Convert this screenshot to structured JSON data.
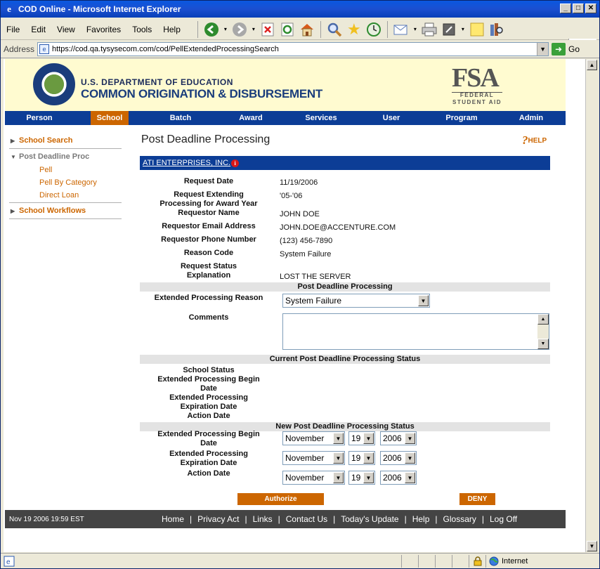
{
  "window": {
    "title": "COD Online - Microsoft Internet Explorer",
    "min_label": "_",
    "max_label": "□",
    "close_label": "✕"
  },
  "menu": {
    "items": [
      {
        "label": "File"
      },
      {
        "label": "Edit"
      },
      {
        "label": "View"
      },
      {
        "label": "Favorites"
      },
      {
        "label": "Tools"
      },
      {
        "label": "Help"
      }
    ]
  },
  "address": {
    "label": "Address",
    "url": "https://cod.qa.tysysecom.com/cod/PellExtendedProcessingSearch",
    "go_label": "Go"
  },
  "status": {
    "zone": "Internet"
  },
  "header": {
    "dept_line1": "U.S. DEPARTMENT OF EDUCATION",
    "dept_line2": "COMMON ORIGINATION & DISBURSEMENT",
    "fsa": "FSA",
    "fsa_sub1": "FEDERAL",
    "fsa_sub2": "STUDENT AID"
  },
  "nav": {
    "items": [
      {
        "label": "Person"
      },
      {
        "label": "School"
      },
      {
        "label": "Batch"
      },
      {
        "label": "Award"
      },
      {
        "label": "Services"
      },
      {
        "label": "User"
      },
      {
        "label": "Program"
      },
      {
        "label": "Admin"
      }
    ],
    "active": "School"
  },
  "sidebar": {
    "school_search": "School Search",
    "post_deadline": "Post Deadline Proc",
    "sub_items": [
      "Pell",
      "Pell By Category",
      "Direct Loan"
    ],
    "school_workflows": "School Workflows"
  },
  "page": {
    "title": "Post Deadline Processing",
    "help": "HELP",
    "school_name": "ATI ENTERPRISES, INC.",
    "info_glyph": "i"
  },
  "request": {
    "request_date_label": "Request Date",
    "request_date": "11/19/2006",
    "award_year_label_1": "Request Extending",
    "award_year_label_2": "Processing for Award Year",
    "award_year": "'05-'06",
    "requestor_name_label": "Requestor Name",
    "requestor_name": "JOHN DOE",
    "email_label": "Requestor Email Address",
    "email": "JOHN.DOE@ACCENTURE.COM",
    "phone_label": "Requestor Phone Number",
    "phone": "(123) 456-7890",
    "reason_code_label": "Reason Code",
    "reason_code": "System Failure",
    "status_expl_label_1": "Request Status",
    "status_expl_label_2": "Explanation",
    "status_expl": "LOST THE SERVER"
  },
  "pdp": {
    "header": "Post Deadline Processing",
    "ext_reason_label": "Extended Processing Reason",
    "ext_reason_value": "System Failure",
    "comments_label": "Comments"
  },
  "current_status": {
    "header": "Current Post Deadline Processing Status",
    "school_status_label": "School Status",
    "begin_label_1": "Extended Processing Begin",
    "begin_label_2": "Date",
    "exp_label_1": "Extended Processing",
    "exp_label_2": "Expiration Date",
    "action_label": "Action Date"
  },
  "new_status": {
    "header": "New Post Deadline Processing Status",
    "begin_label_1": "Extended Processing Begin",
    "begin_label_2": "Date",
    "exp_label_1": "Extended Processing",
    "exp_label_2": "Expiration Date",
    "action_label": "Action Date",
    "begin": {
      "month": "November",
      "day": "19",
      "year": "2006"
    },
    "expiration": {
      "month": "November",
      "day": "19",
      "year": "2006"
    },
    "action": {
      "month": "November",
      "day": "19",
      "year": "2006"
    }
  },
  "buttons": {
    "authorize": "Authorize",
    "deny": "DENY"
  },
  "footer": {
    "timestamp": "Nov 19 2006 19:59 EST",
    "separator": "|",
    "links": [
      "Home",
      "Privacy Act",
      "Links",
      "Contact Us",
      "Today's Update",
      "Help",
      "Glossary",
      "Log Off"
    ]
  },
  "colors": {
    "nav_blue": "#0c3d96",
    "accent_orange": "#cc6600",
    "header_bg": "#fffbd0",
    "footer_bg": "#444444"
  }
}
